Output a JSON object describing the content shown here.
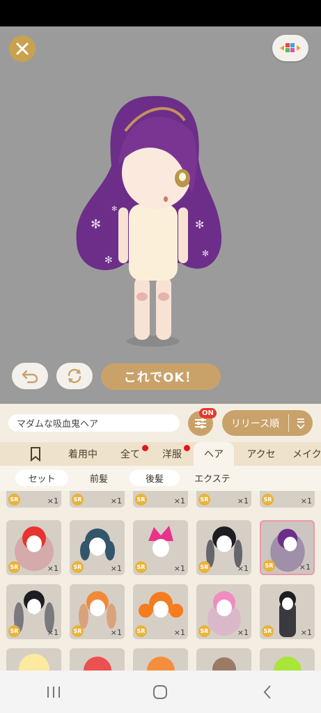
{
  "item_name": "マダムな吸血鬼ヘア",
  "ok_label": "これでOK！",
  "on_badge": "ON",
  "sort_label": "リリース順",
  "tabs": [
    {
      "label": "",
      "icon": "bookmark-icon"
    },
    {
      "label": "着用中"
    },
    {
      "label": "全て",
      "dot": true
    },
    {
      "label": "洋服",
      "dot": true
    },
    {
      "label": "ヘア",
      "active": true
    },
    {
      "label": "アクセ"
    },
    {
      "label": "メイク"
    }
  ],
  "subtabs": [
    {
      "label": "セット"
    },
    {
      "label": "前髪"
    },
    {
      "label": "後髪"
    },
    {
      "label": "エクステ"
    }
  ],
  "items": {
    "rarity": "SR",
    "count": "×1"
  },
  "colors": {
    "gold_accent": "#c9a26a",
    "panel_bg": "#f3ede2",
    "stage_bg": "#9b9b9b",
    "badge_red": "#e7372d"
  }
}
